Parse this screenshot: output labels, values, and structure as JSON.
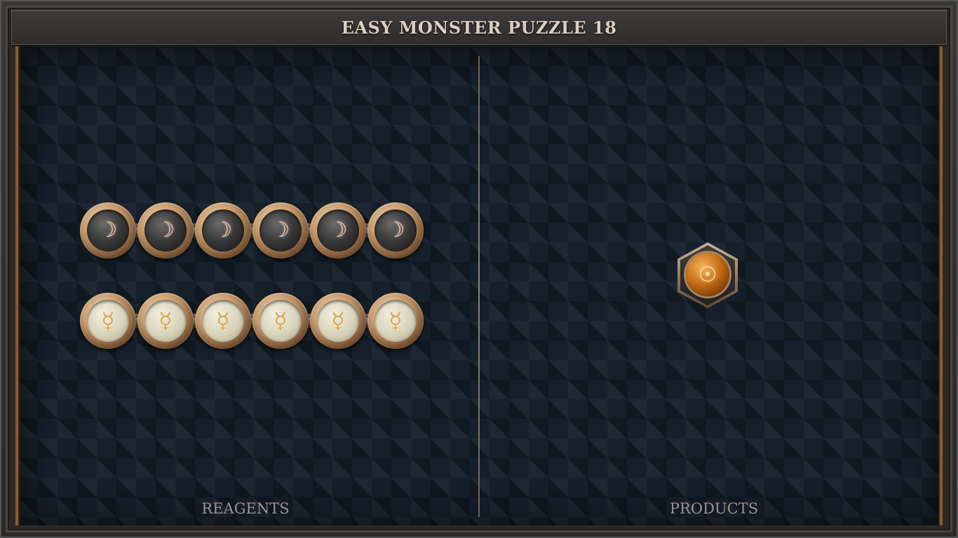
{
  "title": "EASY MONSTER PUZZLE 18",
  "panels": {
    "reagents_label": "REAGENTS",
    "products_label": "PRODUCTS"
  },
  "reagents": [
    {
      "element": "salt",
      "style": "dark",
      "icon": "moon-crescent-icon",
      "glyph": "☽",
      "atoms": [
        "☽",
        "☽",
        "☽",
        "☽",
        "☽",
        "☽"
      ]
    },
    {
      "element": "mercury",
      "style": "light",
      "icon": "mercury-symbol-icon",
      "glyph": "☿",
      "atoms": [
        "☿",
        "☿",
        "☿",
        "☿",
        "☿",
        "☿"
      ]
    }
  ],
  "products": [
    {
      "element": "gold",
      "icon": "sun-symbol-icon",
      "glyph": "☉"
    }
  ],
  "colors": {
    "board_bg": "#16202b",
    "frame_accent": "#8a5a30",
    "title_text": "#d9cfc3",
    "label_text": "#9a948f"
  }
}
